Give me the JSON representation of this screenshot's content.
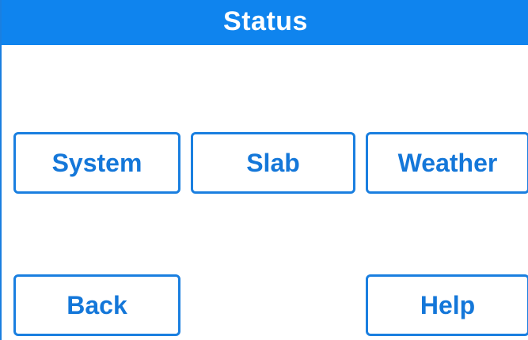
{
  "header": {
    "title": "Status"
  },
  "buttons": {
    "system": "System",
    "slab": "Slab",
    "weather": "Weather",
    "back": "Back",
    "help": "Help"
  },
  "colors": {
    "header_background": "#0f84ee",
    "accent": "#1a7fe0",
    "label_text": "#1477d9",
    "background": "#ffffff"
  }
}
